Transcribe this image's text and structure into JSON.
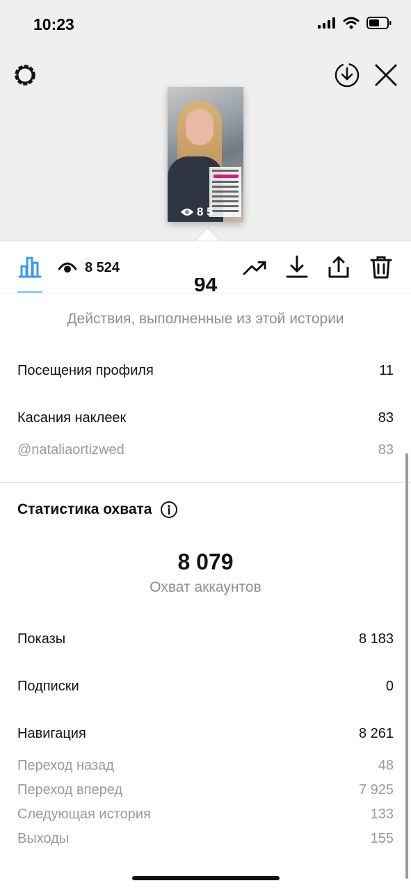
{
  "status": {
    "time": "10:23"
  },
  "story": {
    "views": "8 5"
  },
  "toolbar": {
    "views": "8 524"
  },
  "actions": {
    "total_cut": "94",
    "caption": "Действия, выполненные из этой истории",
    "rows": [
      {
        "label": "Посещения профиля",
        "value": "11"
      },
      {
        "label": "Касания наклеек",
        "value": "83"
      }
    ],
    "sub_rows": [
      {
        "label": "@nataliaortizwed",
        "value": "83"
      }
    ]
  },
  "reach": {
    "title": "Статистика охвата",
    "total": "8 079",
    "caption": "Охват аккаунтов",
    "rows": [
      {
        "label": "Показы",
        "value": "8 183"
      },
      {
        "label": "Подписки",
        "value": "0"
      },
      {
        "label": "Навигация",
        "value": "8 261"
      }
    ],
    "sub_rows": [
      {
        "label": "Переход назад",
        "value": "48"
      },
      {
        "label": "Переход вперед",
        "value": "7 925"
      },
      {
        "label": "Следующая история",
        "value": "133"
      },
      {
        "label": "Выходы",
        "value": "155"
      }
    ]
  },
  "icons": {
    "settings": "gear-icon",
    "download_circle": "download-circle-icon",
    "close": "close-icon",
    "insights": "bar-chart-icon",
    "eye": "eye-icon",
    "promote": "trending-up-icon",
    "download": "download-icon",
    "share": "share-icon",
    "delete": "trash-icon"
  },
  "colors": {
    "accent": "#3897f0",
    "tab_underline": "#6ec5f2",
    "muted": "#8e8e8e"
  }
}
